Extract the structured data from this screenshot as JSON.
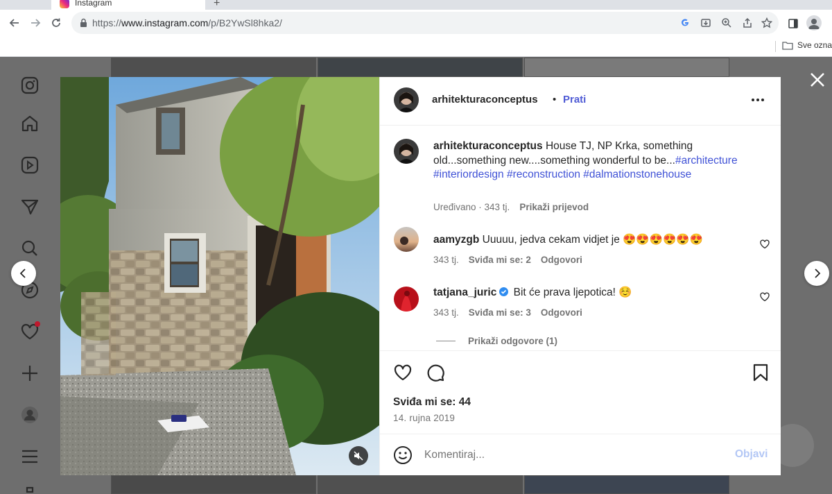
{
  "browser": {
    "tab_title": "Instagram",
    "url_prefix": "https://",
    "url_domain": "www.instagram.com",
    "url_path": "/p/B2YwSl8hka2/",
    "bookmarks_folder": "Sve oznake"
  },
  "post": {
    "username": "arhitekturaconceptus",
    "separator": "•",
    "follow_label": "Prati",
    "caption_user": "arhitekturaconceptus",
    "caption_text": "House TJ, NP Krka, something old...something new....something wonderful to be...",
    "hashtags": [
      "#architecture",
      "#interiordesign",
      "#reconstruction",
      "#dalmationstonehouse"
    ],
    "caption_meta": "Uređivano · 343 tj.",
    "translate_label": "Prikaži prijevod",
    "likes": "Sviđa mi se: 44",
    "date": "14. rujna 2019"
  },
  "comments": [
    {
      "user": "aamyzgb",
      "text": "Uuuuu, jedva cekam vidjet je 😍😍😍😍😍😍",
      "age": "343 tj.",
      "likes_label": "Sviđa mi se: 2",
      "reply_label": "Odgovori"
    },
    {
      "user": "tatjana_juric",
      "text": "Bit će prava ljepotica! ☺️",
      "age": "343 tj.",
      "likes_label": "Sviđa mi se: 3",
      "reply_label": "Odgovori"
    }
  ],
  "view_replies": "Prikaži odgovore (1)",
  "composer": {
    "placeholder": "Komentiraj...",
    "post_label": "Objavi"
  },
  "colors": {
    "link": "#4f5bd5",
    "hashtag": "#3f51d6",
    "post_disabled": "#b3c7f5",
    "notification": "#c0182d"
  }
}
